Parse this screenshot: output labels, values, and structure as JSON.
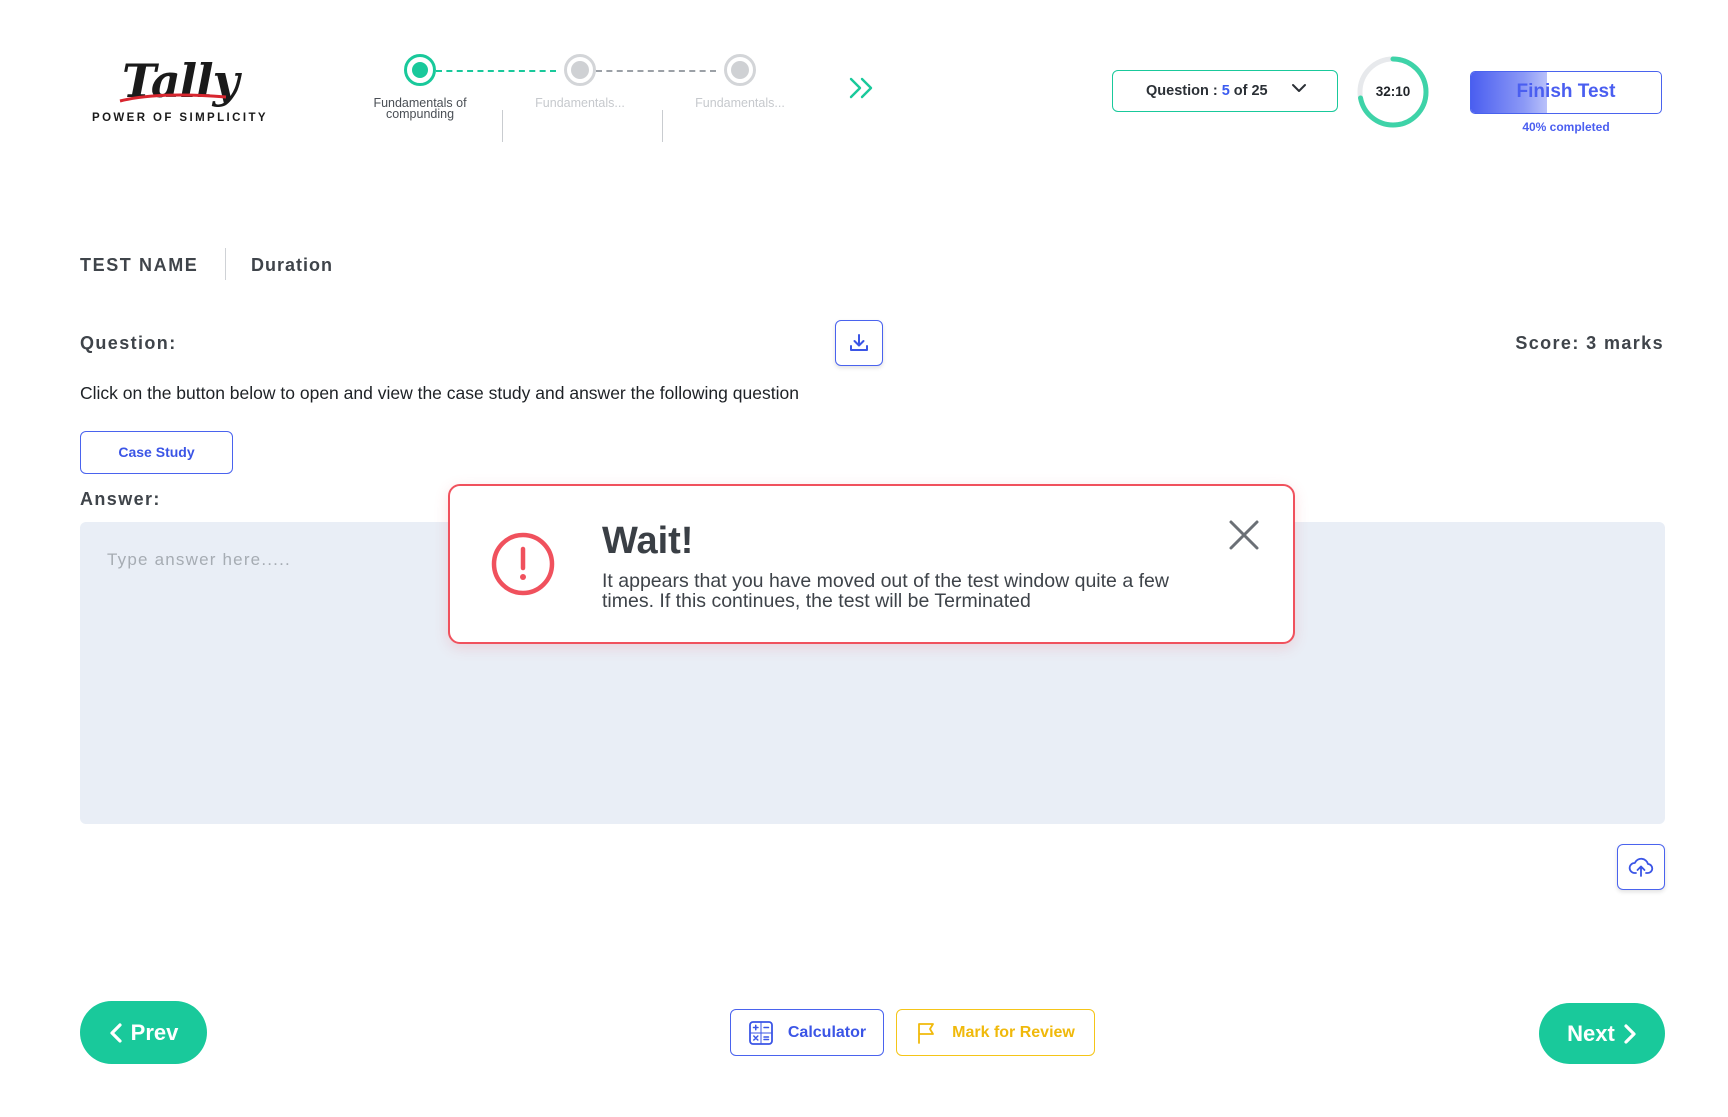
{
  "brand": {
    "logo_text": "Tally",
    "tagline": "POWER OF SIMPLICITY"
  },
  "stepper": {
    "steps": [
      {
        "label": "Fundamentals of compunding",
        "state": "active"
      },
      {
        "label": "Fundamentals...",
        "state": "todo"
      },
      {
        "label": "Fundamentals...",
        "state": "todo"
      }
    ],
    "more_icon": "double-chevron-right-icon"
  },
  "question_selector": {
    "prefix": "Question :",
    "current": "5",
    "suffix": "of 25"
  },
  "timer": {
    "time": "32:10",
    "remaining_fraction": 0.72
  },
  "finish": {
    "label": "Finish Test",
    "progress_percent": 40,
    "progress_text": "40% completed"
  },
  "test": {
    "name": "TEST NAME",
    "duration_label": "Duration"
  },
  "question": {
    "label": "Question:",
    "score": "Score: 3 marks",
    "text": "Click on the button below to open and view the case study and answer the following question",
    "case_study_button": "Case Study"
  },
  "answer": {
    "label": "Answer:",
    "placeholder": "Type answer here....."
  },
  "alert": {
    "title": "Wait!",
    "message": "It appears that you have moved out of the test window quite a few times. If this continues, the test will be Terminated",
    "icon": "exclamation-circle-icon"
  },
  "footer": {
    "prev": "Prev",
    "next": "Next",
    "calculator": "Calculator",
    "mark_review": "Mark for Review"
  },
  "colors": {
    "accent_green": "#19c99b",
    "accent_blue": "#4a63ee",
    "alert_red": "#f0515d",
    "review_yellow": "#f5c518",
    "answer_bg": "#e9eef6"
  }
}
